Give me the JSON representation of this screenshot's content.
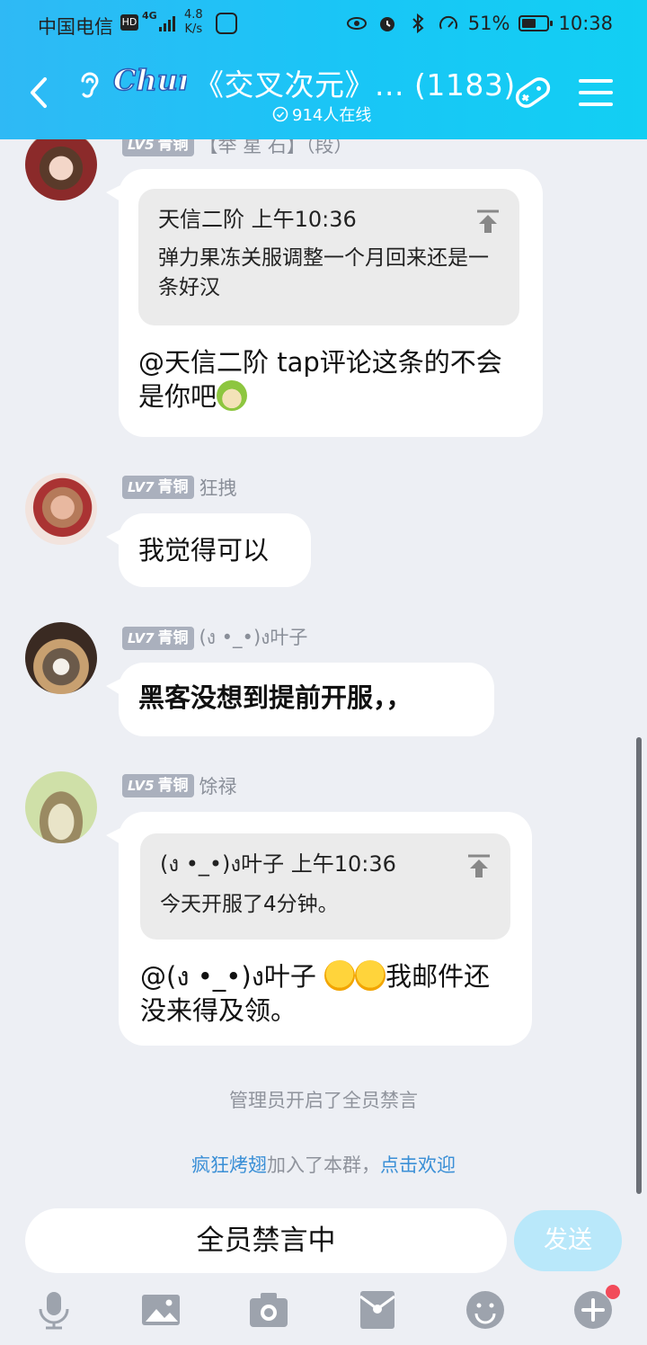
{
  "status_bar": {
    "carrier": "中国电信",
    "hd": "HD",
    "network": "4G",
    "speed_value": "4.8",
    "speed_unit": "K/s",
    "battery": "51%",
    "time": "10:38"
  },
  "header": {
    "logo_text": "Chum",
    "title": "《交叉次元》... (1183)",
    "online": "914人在线"
  },
  "messages": [
    {
      "level": "LV5",
      "rank": "青铜",
      "name": "【举 星 石】（段）",
      "quote_author": "天信二阶",
      "quote_time": "上午10:36",
      "quote_text": "弹力果冻关服调整一个月回来还是一条好汉",
      "text": "@天信二阶 tap评论这条的不会是你吧"
    },
    {
      "level": "LV7",
      "rank": "青铜",
      "name": "狂拽",
      "text": "我觉得可以"
    },
    {
      "level": "LV7",
      "rank": "青铜",
      "name": "(ง •_•)ง叶子",
      "text": "黑客没想到提前开服，，"
    },
    {
      "level": "LV5",
      "rank": "青铜",
      "name": "馀禄",
      "quote_author": "(ง •_•)ง叶子",
      "quote_time": "上午10:36",
      "quote_text": "今天开服了4分钟。",
      "text_prefix": "@(ง •_•)ง叶子 ",
      "text": "我邮件还没来得及领。"
    }
  ],
  "system": {
    "mute_notice": "管理员开启了全员禁言",
    "join_user": "疯狂烤翅",
    "join_text": "加入了本群，",
    "join_action": "点击欢迎"
  },
  "input": {
    "muted_text": "全员禁言中",
    "send_label": "发送"
  },
  "toolbar": [
    "mic-icon",
    "image-icon",
    "camera-icon",
    "red-packet-icon",
    "emoji-icon",
    "plus-icon"
  ],
  "colors": {
    "header": "#19c6f6",
    "background": "#edeff4",
    "link": "#3a8fd6",
    "badge": "#aab0bd",
    "send_disabled": "#b9e8fa",
    "notify_dot": "#f24b5a"
  }
}
